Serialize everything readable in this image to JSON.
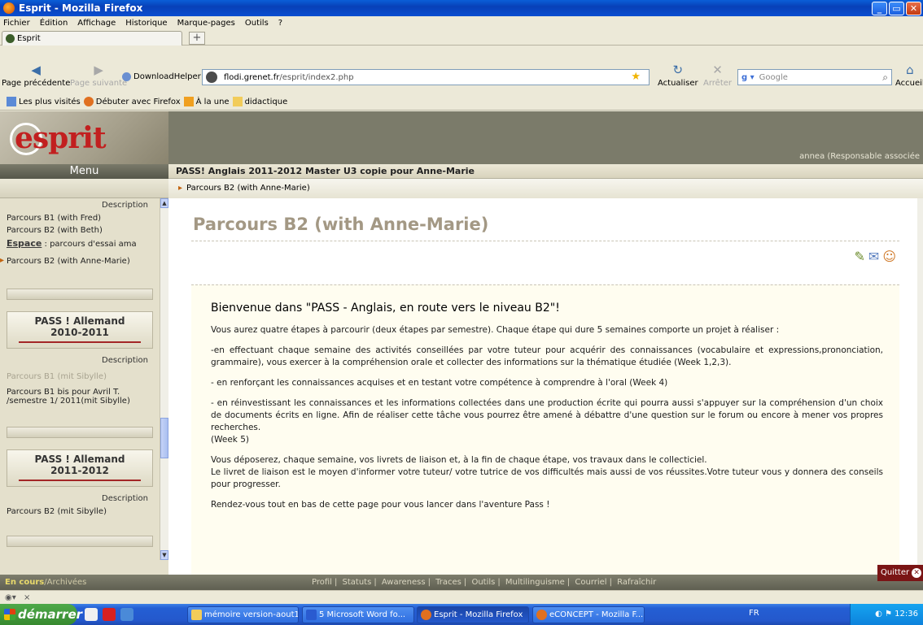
{
  "window": {
    "title": "Esprit - Mozilla Firefox"
  },
  "menubar": {
    "items": [
      "Fichier",
      "Édition",
      "Affichage",
      "Historique",
      "Marque-pages",
      "Outils",
      "?"
    ]
  },
  "tabs": {
    "active_tab": "Esprit",
    "new_tab": "+"
  },
  "navbar": {
    "back": "Page précédente",
    "forward": "Page suivante",
    "download_helper": "DownloadHelper",
    "url_host": "flodi.grenet.fr",
    "url_path": "/esprit/index2.php",
    "reload": "Actualiser",
    "stop": "Arrêter",
    "search_placeholder": "Google",
    "home": "Accueil"
  },
  "bookmarks": {
    "items": [
      "Les plus visités",
      "Débuter avec Firefox",
      "À la une",
      "didactique"
    ]
  },
  "sidebar": {
    "menu_title": "Menu",
    "description1": "Description",
    "item1": "Parcours B1 (with Fred)",
    "item2": "Parcours B2 (with Beth)",
    "espace_label": "Espace",
    "espace_text": " : parcours d'essai ama",
    "current_item": "Parcours B2 (with Anne-Marie)",
    "group1_title_1": "PASS ! Allemand",
    "group1_title_2": "2010-2011",
    "description2": "Description",
    "group1_item1": "Parcours B1 (mit Sibylle)",
    "group1_item2": "Parcours B1 bis pour Avril T. /semestre 1/ 2011(mit Sibylle)",
    "group2_title_1": "PASS ! Allemand",
    "group2_title_2": "2011-2012",
    "description3": "Description",
    "group2_item1": "Parcours B2 (mit Sibylle)"
  },
  "header": {
    "logo_text": "esprit",
    "user": "annea (Responsable associée",
    "course_title": "PASS! Anglais 2011-2012 Master U3 copie pour Anne-Marie",
    "breadcrumb": "Parcours B2 (with Anne-Marie)"
  },
  "main": {
    "title": "Parcours B2 (with Anne-Marie)",
    "heading": "Bienvenue dans \"PASS - Anglais, en route vers le niveau B2\"!",
    "p1": "Vous aurez quatre étapes à parcourir (deux étapes par semestre). Chaque étape qui dure 5 semaines comporte un projet à réaliser  :",
    "p2": "-en effectuant chaque semaine des activités conseillées par votre tuteur pour acquérir des connaissances (vocabulaire et expressions,prononciation, grammaire), vous exercer à la compréhension orale et collecter des informations sur la thématique étudiée (Week 1,2,3).",
    "p3": "- en renforçant  les connaissances acquises et en testant votre compétence à comprendre à l'oral (Week 4)",
    "p4": "- en réinvestissant les connaissances et les informations collectées dans une production écrite qui pourra aussi s'appuyer sur la compréhension d'un choix de documents écrits en ligne. Afin de réaliser cette tâche vous pourrez être amené à débattre d'une question sur le forum ou encore à mener vos propres recherches.",
    "p4b": "(Week 5)",
    "p5": "Vous déposerez, chaque semaine, vos livrets de liaison et, à la fin de chaque étape, vos travaux dans le collecticiel.",
    "p6": "Le livret de liaison est le moyen d'informer votre tuteur/ votre tutrice de vos difficultés mais aussi de vos réussites.Votre tuteur vous y donnera des conseils pour progresser.",
    "p7": "Rendez-vous tout en bas de cette page pour vous lancer dans l'aventure Pass !"
  },
  "statusbar": {
    "en_cours": "En cours",
    "archivees": "/Archivées",
    "links": [
      "Profil",
      "Statuts",
      "Awareness",
      "Traces",
      "Outils",
      "Multilinguisme",
      "Courriel",
      "Rafraîchir"
    ],
    "quit": "Quitter"
  },
  "ffstatus": {
    "close": "×"
  },
  "taskbar": {
    "start": "démarrer",
    "tasks": [
      "mémoire version-aout18",
      "5 Microsoft Word fo...",
      "Esprit - Mozilla Firefox",
      "eCONCEPT - Mozilla F..."
    ],
    "lang": "FR",
    "clock": "12:36"
  }
}
